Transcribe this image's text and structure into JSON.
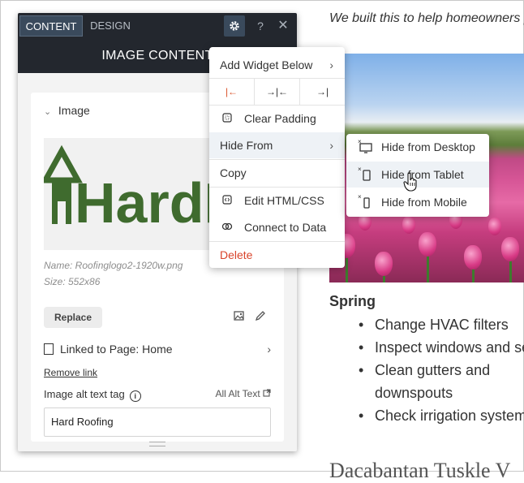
{
  "page": {
    "intro_text": "We built this to help homeowners p",
    "season": "Spring",
    "tips": [
      "Change HVAC filters",
      "Inspect windows and se",
      "Clean gutters and",
      "downspouts",
      "Check irrigation system"
    ],
    "next_heading": "Dacabantan Tuskle V"
  },
  "panel": {
    "tabs": {
      "content": "CONTENT",
      "design": "DESIGN"
    },
    "help_label": "?",
    "close_label": "✕",
    "title": "IMAGE CONTENT",
    "section": "Image",
    "logo_text": "HardRoo",
    "name_line": "Name: Roofinglogo2-1920w.png",
    "size_line": "Size: 552x86",
    "replace_label": "Replace",
    "linked_label": "Linked to Page: Home",
    "remove_link": "Remove link",
    "alt_label": "Image alt text tag",
    "all_alt_label": "All Alt Text",
    "alt_value": "Hard Roofing"
  },
  "menu": {
    "add_widget_below": "Add Widget Below",
    "clear_padding": "Clear Padding",
    "hide_from": "Hide From",
    "copy": "Copy",
    "edit_html": "Edit HTML/CSS",
    "connect_data": "Connect to Data",
    "delete": "Delete"
  },
  "submenu": {
    "desktop": "Hide from Desktop",
    "tablet": "Hide from Tablet",
    "mobile": "Hide from Mobile"
  },
  "colors": {
    "dark_header": "#23272e",
    "active_tab": "#3a4a5c",
    "accent_orange": "#d9542b",
    "delete_red": "#d9442b",
    "logo_green": "#3f6b2e"
  }
}
